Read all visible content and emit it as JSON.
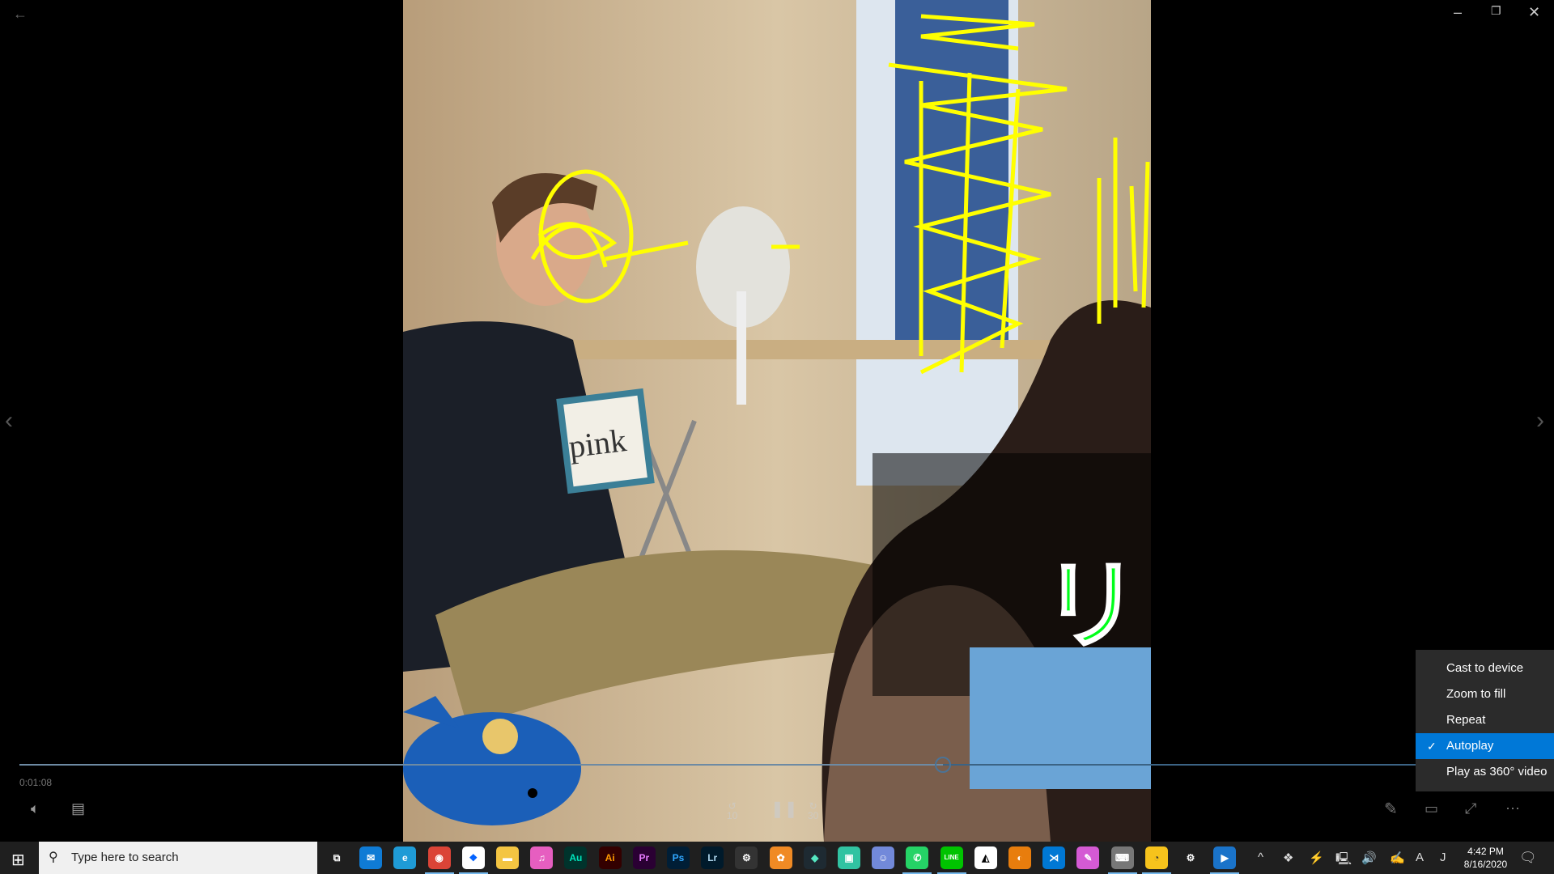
{
  "window": {
    "back_icon": "arrow-left-icon",
    "controls": [
      "minimize",
      "restore",
      "close"
    ]
  },
  "video": {
    "card_text": "pink",
    "overlay_char": "リ"
  },
  "player": {
    "time": "0:01:08",
    "progress": 0.61,
    "center_controls": [
      {
        "name": "rewind-10",
        "label": "10"
      },
      {
        "name": "pause"
      },
      {
        "name": "forward-30",
        "label": "30"
      }
    ]
  },
  "menu": {
    "items": [
      {
        "label": "Cast to device",
        "checked": false
      },
      {
        "label": "Zoom to fill",
        "checked": false
      },
      {
        "label": "Repeat",
        "checked": false
      },
      {
        "label": "Autoplay",
        "checked": true
      },
      {
        "label": "Play as 360° video",
        "checked": false
      }
    ],
    "check_glyph": "✓",
    "highlight_color": "#0078d7"
  },
  "taskbar": {
    "search_placeholder": "Type here to search",
    "apps": [
      {
        "name": "task-view",
        "glyph": "⧉",
        "bg": "transparent"
      },
      {
        "name": "mail",
        "glyph": "✉",
        "bg": "#0f7bd5"
      },
      {
        "name": "edge",
        "glyph": "e",
        "bg": "#1f9bd6",
        "running": false
      },
      {
        "name": "chrome",
        "glyph": "◉",
        "bg": "#db4437",
        "running": true
      },
      {
        "name": "dropbox",
        "glyph": "❖",
        "bg": "#ffffff",
        "fg": "#0061ff",
        "running": true
      },
      {
        "name": "file-explorer",
        "glyph": "▬",
        "bg": "#f4c542"
      },
      {
        "name": "itunes",
        "glyph": "♫",
        "bg": "#e65ec0"
      },
      {
        "name": "audition",
        "glyph": "Au",
        "bg": "#00332c",
        "fg": "#00e4bb"
      },
      {
        "name": "illustrator",
        "glyph": "Ai",
        "bg": "#330000",
        "fg": "#ff9a00"
      },
      {
        "name": "premiere",
        "glyph": "Pr",
        "bg": "#2a0033",
        "fg": "#e77cff"
      },
      {
        "name": "photoshop",
        "glyph": "Ps",
        "bg": "#001e36",
        "fg": "#31a8ff"
      },
      {
        "name": "lightroom",
        "glyph": "Lr",
        "bg": "#001a2b",
        "fg": "#add5ec"
      },
      {
        "name": "tascam",
        "glyph": "⚙",
        "bg": "#333"
      },
      {
        "name": "fl-studio",
        "glyph": "✿",
        "bg": "#f08a24"
      },
      {
        "name": "filmora",
        "glyph": "◆",
        "bg": "#1e2a32",
        "fg": "#55e6c1"
      },
      {
        "name": "streamlabs",
        "glyph": "▣",
        "bg": "#31c3a2"
      },
      {
        "name": "discord",
        "glyph": "☺",
        "bg": "#7289da"
      },
      {
        "name": "whatsapp",
        "glyph": "✆",
        "bg": "#25d366",
        "running": true
      },
      {
        "name": "line",
        "glyph": "LINE",
        "bg": "#00c300",
        "running": true
      },
      {
        "name": "unity",
        "glyph": "◭",
        "bg": "#ffffff",
        "fg": "#000"
      },
      {
        "name": "blender",
        "glyph": "◐",
        "bg": "#e87d0d"
      },
      {
        "name": "vscode",
        "glyph": "⋊",
        "bg": "#0078d4"
      },
      {
        "name": "krita",
        "glyph": "✎",
        "bg": "#d45ad4"
      },
      {
        "name": "capture-tool",
        "glyph": "⌨",
        "bg": "#777",
        "running": true
      },
      {
        "name": "lino",
        "glyph": "◔",
        "bg": "#f6c31c",
        "fg": "#333",
        "running": true
      },
      {
        "name": "settings",
        "glyph": "⚙",
        "bg": "transparent"
      },
      {
        "name": "movies-tv",
        "glyph": "▶",
        "bg": "#1a73c9",
        "running": true
      }
    ],
    "tray": [
      {
        "name": "show-hidden",
        "glyph": "^"
      },
      {
        "name": "dropbox",
        "glyph": "❖"
      },
      {
        "name": "battery",
        "glyph": "⚡"
      },
      {
        "name": "network",
        "glyph": "🖳"
      },
      {
        "name": "volume",
        "glyph": "🔊"
      },
      {
        "name": "pen",
        "glyph": "✍"
      },
      {
        "name": "ime",
        "glyph": "A"
      },
      {
        "name": "ime-mode",
        "glyph": "J"
      }
    ],
    "time": "4:42 PM",
    "date": "8/16/2020"
  }
}
